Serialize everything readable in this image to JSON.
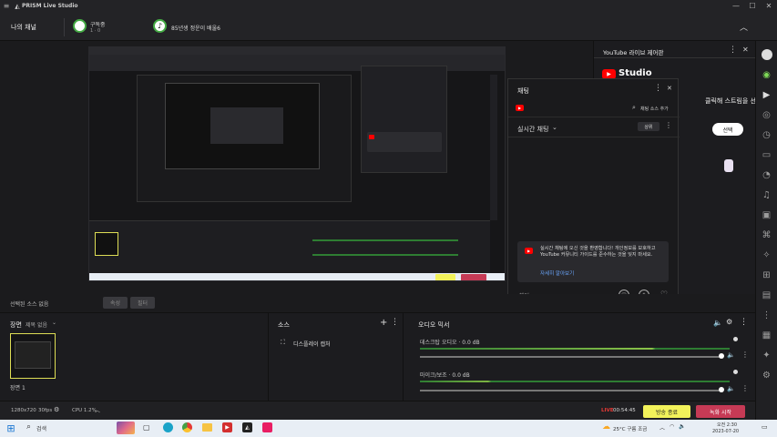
{
  "app": {
    "title": "PRISM Live Studio"
  },
  "header": {
    "my_channel": "나의 채널",
    "subscriber_label": "구독중",
    "subscriber_count": "1 · 0",
    "notice": "85년생 정운이 배울6"
  },
  "youtube_panel": {
    "title": "YouTube 라이브 제어판",
    "studio_label": "Studio",
    "hint": "클릭해 스트림을 선택",
    "confirm": "선택"
  },
  "chat": {
    "title": "채팅",
    "add_source": "채팅 소스 추가",
    "live_chat": "실시간 채팅",
    "top_btn": "상위",
    "notice_text": "실시간 채팅에 오신 것을 환영합니다! 개인정보를 보호하고 YouTube 커뮤니티 가이드를 준수하는 것을 잊지 마세요.",
    "learn_more": "자세히 알아보기",
    "input_placeholder": "채팅..."
  },
  "source_row": {
    "label": "선택된 소스 없음",
    "btn1": "속성",
    "btn2": "필터"
  },
  "scenes": {
    "title": "장면",
    "subtitle": "제목 없음",
    "scene1": "장면 1"
  },
  "sources": {
    "title": "소스",
    "item1": "디스플레이 캡처"
  },
  "mixer": {
    "title": "오디오 믹서",
    "ch1": "데스크탑 오디오 · 0.0 dB",
    "ch2": "마이크/보조 · 0.0 dB"
  },
  "status": {
    "resolution": "1280x720",
    "fps": "30fps",
    "cpu": "CPU 1.2%",
    "live": "LIVE",
    "time": "00:54:45",
    "stop_stream": "방송 종료",
    "record": "녹화 시작"
  },
  "taskbar": {
    "search": "검색",
    "weather": "25°C 구름 조금",
    "time": "오전 2:30",
    "date": "2023-07-20"
  },
  "colors": {
    "accent_yellow": "#f2f25a",
    "record_red": "#c63a55",
    "youtube_red": "#ff0000"
  }
}
